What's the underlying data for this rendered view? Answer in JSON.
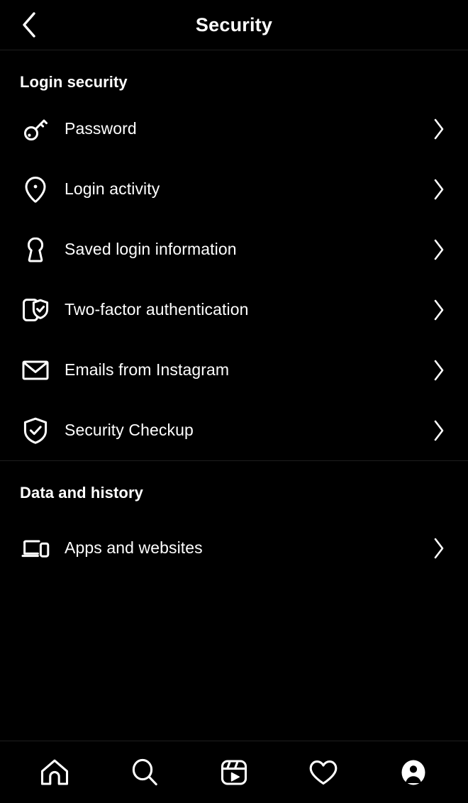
{
  "header": {
    "title": "Security",
    "back_icon": "chevron-left-icon"
  },
  "sections": [
    {
      "id": "login-security",
      "title": "Login security",
      "items": [
        {
          "label": "Password",
          "icon": "key-icon",
          "chevron": "chevron-right-icon"
        },
        {
          "label": "Login activity",
          "icon": "location-pin-icon",
          "chevron": "chevron-right-icon"
        },
        {
          "label": "Saved login information",
          "icon": "keyhole-icon",
          "chevron": "chevron-right-icon"
        },
        {
          "label": "Two-factor authentication",
          "icon": "phone-shield-check-icon",
          "chevron": "chevron-right-icon"
        },
        {
          "label": "Emails from Instagram",
          "icon": "envelope-icon",
          "chevron": "chevron-right-icon"
        },
        {
          "label": "Security Checkup",
          "icon": "shield-check-icon",
          "chevron": "chevron-right-icon"
        }
      ]
    },
    {
      "id": "data-and-history",
      "title": "Data and history",
      "items": [
        {
          "label": "Apps and websites",
          "icon": "devices-icon",
          "chevron": "chevron-right-icon"
        }
      ]
    }
  ],
  "bottom_nav": [
    {
      "id": "home",
      "icon": "home-icon",
      "active": false
    },
    {
      "id": "search",
      "icon": "search-icon",
      "active": false
    },
    {
      "id": "reels",
      "icon": "reels-icon",
      "active": false
    },
    {
      "id": "activity",
      "icon": "heart-icon",
      "active": false
    },
    {
      "id": "profile",
      "icon": "profile-avatar-icon",
      "active": true
    }
  ],
  "colors": {
    "background": "#000000",
    "foreground": "#ffffff",
    "divider": "#1e1e1e"
  }
}
